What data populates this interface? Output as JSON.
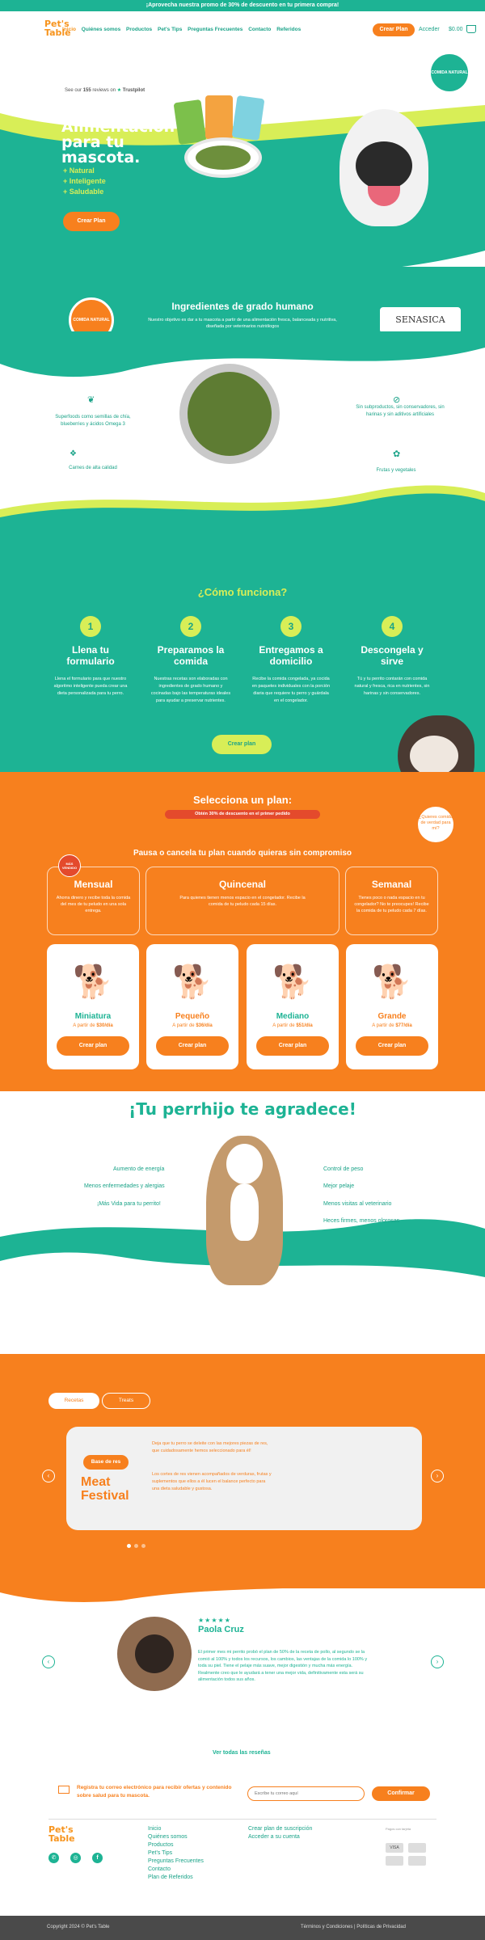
{
  "topbar": {
    "text": "¡Aprovecha nuestra promo de 30% de descuento en tu primera compra!"
  },
  "nav": {
    "logo": "Pet's Table",
    "links": [
      "Inicio",
      "Quiénes somos",
      "Productos",
      "Pet's Tips",
      "Preguntas Frecuentes",
      "Contacto",
      "Referidos"
    ],
    "cta": "Crear Plan",
    "account": "Acceder",
    "cart": "$0.00"
  },
  "hero": {
    "trustpilot_prefix": "See our",
    "trustpilot_count": "155",
    "trustpilot_suffix": "reviews on",
    "trustpilot_brand": "Trustpilot",
    "title": "Alimentación para tu mascota.",
    "bullets": [
      "+ Natural",
      "+ Inteligente",
      "+ Saludable"
    ],
    "cta": "Crear Plan",
    "badge": "COMIDA NATURAL"
  },
  "ingredients": {
    "badge": "COMIDA NATURAL",
    "title": "Ingredientes de grado humano",
    "text": "Nuestro objetivo es dar a tu mascota a partir de una alimentación fresca, balanceada y nutritiva, diseñada por veterinarios nutriólogos",
    "brand": "SENASICA",
    "features": [
      "Superfoods como semillas de chía, blueberries y ácidos Omega 3",
      "Carnes de alta calidad",
      "Sin subproductos, sin conservadores, sin harinas y sin aditivos artificiales",
      "Frutas y vegetales"
    ]
  },
  "how": {
    "title": "¿Cómo funciona?",
    "steps": [
      {
        "num": "1",
        "title": "Llena tu formulario",
        "text": "Llena el formulario para que nuestro algoritmo inteligente pueda crear una dieta personalizada para tu perro."
      },
      {
        "num": "2",
        "title": "Preparamos la comida",
        "text": "Nuestras recetas son elaboradas con ingredientes de grado humano y cocinadas bajo las temperaturas ideales para ayudar a preservar nutrientes."
      },
      {
        "num": "3",
        "title": "Entregamos a domicilio",
        "text": "Recibe la comida congelada, ya cocida en paquetes individuales con la porción diaria que requiere tu perro y guárdala en el congelador."
      },
      {
        "num": "4",
        "title": "Descongela y sirve",
        "text": "Tú y tu perrito contarán con comida natural y fresca, rica en nutrientes, sin harinas y sin conservadores."
      }
    ],
    "cta": "Crear plan",
    "bubble": "¿Quieres comida de verdad para mí?"
  },
  "plans": {
    "title": "Selecciona un plan:",
    "discount": "Obtén 30% de descuento en el primer pedido",
    "subtitle": "Pausa o cancela tu plan cuando quieras sin compromiso",
    "badge": "MÁS VENDIDO",
    "types": [
      {
        "name": "Mensual",
        "text": "Ahorra dinero y recibe toda la comida del mes de tu peludo en una sola entrega."
      },
      {
        "name": "Quincenal",
        "text": "Para quienes tienen menos espacio en el congelador. Recibe la comida de tu peludo cada 15 días."
      },
      {
        "name": "Semanal",
        "text": "Tienes poco o nada espacio en tu congelador? No te preocupes! Recibe la comida de tu peludo cada 7 días."
      }
    ],
    "sizes": [
      {
        "name": "Miniatura",
        "price_prefix": "A partir de",
        "price": "$30/día",
        "cta": "Crear plan"
      },
      {
        "name": "Pequeño",
        "price_prefix": "A partir de",
        "price": "$36/día",
        "cta": "Crear plan"
      },
      {
        "name": "Mediano",
        "price_prefix": "A partir de",
        "price": "$51/día",
        "cta": "Crear plan"
      },
      {
        "name": "Grande",
        "price_prefix": "A partir de",
        "price": "$77/día",
        "cta": "Crear plan"
      }
    ]
  },
  "thanks": {
    "title": "¡Tu perrhijo te agradece!",
    "left": [
      "Aumento de energía",
      "Menos enfermedades y alergias",
      "¡Más Vida para tu perrito!"
    ],
    "right": [
      "Control de peso",
      "Mejor pelaje",
      "Menos visitas al veterinario",
      "Heces firmes, menos olorosas"
    ]
  },
  "recipes": {
    "tabs": [
      "Recetas",
      "Treats"
    ],
    "tag": "Base de res",
    "title": "Meat Festival",
    "desc1": "Deja que tu perro se deleite con las mejores piezas de res, que cuidadosamente hemos seleccionado para él!",
    "desc2": "Los cortes de res vienen acompañados de verduras, frutas y suplementos que ellos a él lucen el balance perfecto para una dieta saludable y gustosa."
  },
  "review": {
    "stars": "★★★★★",
    "name": "Paola Cruz",
    "text": "El primer mes mi perrito probó el plan de 50% de la receta de pollo, al segundo se la comió al 100% y todos los recursos, los cambios, las ventajas de la comida lo 100% y toda su piel. Tiene el pelaje más suave, mejor digestión y mucha más energía. Realmente creo que le ayudará a tener una mejor vida, definitivamente esta será su alimentación todos sus años.",
    "all_link": "Ver todas las reseñas"
  },
  "newsletter": {
    "text": "Registra tu correo electrónico para recibir ofertas y contenido sobre salud para tu mascota.",
    "placeholder": "Escribe tu correo aquí",
    "cta": "Confirmar"
  },
  "footer": {
    "col1": [
      "Inicio",
      "Quiénes somos",
      "Productos",
      "Pet's Tips",
      "Preguntas Frecuentes",
      "Contacto",
      "Plan de Referidos"
    ],
    "col2": [
      "Crear plan de suscripción",
      "Acceder a su cuenta"
    ],
    "payment_note": "Pagos con tarjeta",
    "copyright": "Copyright 2024 © Pet's Table",
    "legal": "Términos y Condiciones | Políticas de Privacidad"
  }
}
